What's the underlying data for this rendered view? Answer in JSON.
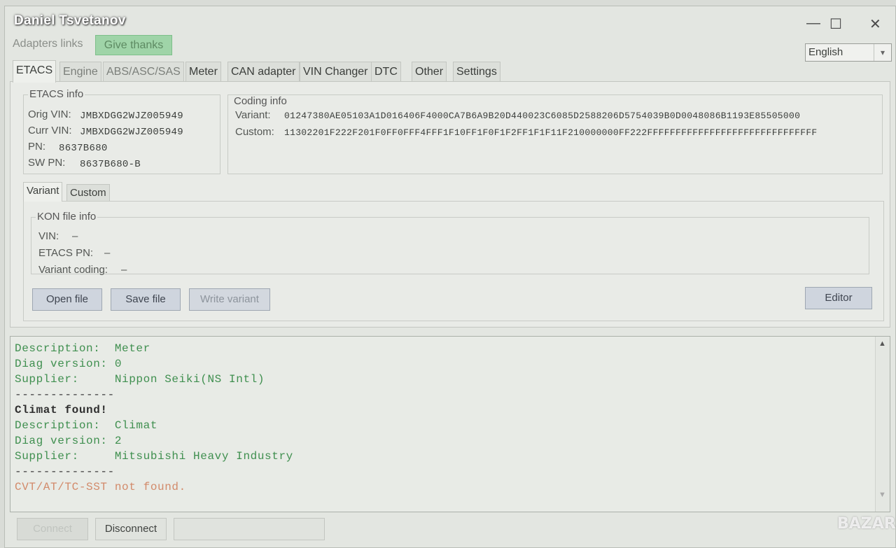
{
  "window": {
    "title": "Daniel Tsvetanov",
    "minimize": "—",
    "maximize": "☐",
    "close": "✕"
  },
  "top": {
    "adapters_links": "Adapters links",
    "give_thanks": "Give thanks",
    "language": "English"
  },
  "tabs": [
    {
      "label": "ETACS",
      "active": true
    },
    {
      "label": "Engine"
    },
    {
      "label": "ABS/ASC/SAS"
    },
    {
      "label": "Meter"
    },
    {
      "label": "CAN adapter"
    },
    {
      "label": "VIN Changer"
    },
    {
      "label": "DTC"
    },
    {
      "label": "Other"
    },
    {
      "label": "Settings"
    }
  ],
  "etacs_info": {
    "title": "ETACS info",
    "orig_vin_label": "Orig VIN:",
    "orig_vin": "JMBXDGG2WJZ005949",
    "curr_vin_label": "Curr VIN:",
    "curr_vin": "JMBXDGG2WJZ005949",
    "pn_label": "PN:",
    "pn": "8637B680",
    "sw_pn_label": "SW PN:",
    "sw_pn": "8637B680-B"
  },
  "coding_info": {
    "title": "Coding info",
    "variant_label": "Variant:",
    "variant": "01247380AE05103A1D016406F4000CA7B6A9B20D440023C6085D2588206D5754039B0D0048086B1193E85505000",
    "custom_label": "Custom:",
    "custom": "11302201F222F201F0FF0FFF4FFF1F10FF1F0F1F2FF1F1F11F210000000FF222FFFFFFFFFFFFFFFFFFFFFFFFFFFFFF"
  },
  "subtabs": [
    {
      "label": "Variant",
      "active": true
    },
    {
      "label": "Custom"
    }
  ],
  "kon": {
    "title": "KON file info",
    "vin_label": "VIN:",
    "vin": "–",
    "etacs_pn_label": "ETACS PN:",
    "etacs_pn": "–",
    "variant_coding_label": "Variant coding:",
    "variant_coding": "–"
  },
  "buttons": {
    "open_file": "Open file",
    "save_file": "Save file",
    "write_variant": "Write variant",
    "editor": "Editor",
    "connect": "Connect",
    "disconnect": "Disconnect"
  },
  "log": [
    {
      "text": "Description:  Meter",
      "color": "#3f8f4f"
    },
    {
      "text": "Diag version: 0",
      "color": "#3f8f4f"
    },
    {
      "text": "Supplier:     Nippon Seiki(NS Intl)",
      "color": "#3f8f4f"
    },
    {
      "text": "--------------",
      "color": "#3a3a3a"
    },
    {
      "text": "Climat found!",
      "color": "#2f2f2f"
    },
    {
      "text": "Description:  Climat",
      "color": "#3f8f4f"
    },
    {
      "text": "Diag version: 2",
      "color": "#3f8f4f"
    },
    {
      "text": "Supplier:     Mitsubishi Heavy Industry",
      "color": "#3f8f4f"
    },
    {
      "text": "--------------",
      "color": "#3a3a3a"
    },
    {
      "text": "CVT/AT/TC-SST not found.",
      "color": "#d28a6a"
    }
  ],
  "watermark": "BAZAR"
}
